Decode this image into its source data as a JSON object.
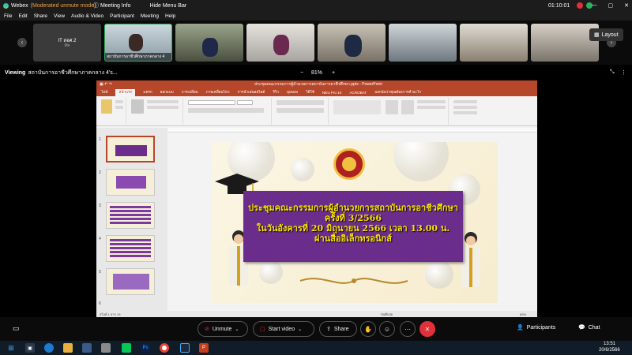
{
  "titlebar": {
    "app_name": "Webex",
    "mode": "(Moderated unmute mode)",
    "meeting_info": "Meeting Info",
    "hide_menu_bar": "Hide Menu Bar",
    "timer": "01:10:01"
  },
  "menu": {
    "file": "File",
    "edit": "Edit",
    "share": "Share",
    "view": "View",
    "audio_video": "Audio & Video",
    "participant": "Participant",
    "meeting": "Meeting",
    "help": "Help"
  },
  "strip": {
    "self_name": "IT สอศ.2",
    "self_sub": "Me",
    "active_label": "สถาบันการอาชีวศึกษาภาคกลาง 4",
    "layout_label": "Layout"
  },
  "viewbar": {
    "viewing": "Viewing",
    "screen_of": "สถาบันการอาชีวศึกษาภาคกลาง 4's...",
    "zoom": "81%"
  },
  "ppt": {
    "filename": "ประชุมคณะกรรมการผู้อำนวยการสถาบันการอาชีวศึกษา.pptx - PowerPoint",
    "tabs": [
      "ไฟล์",
      "หน้าแรก",
      "แทรก",
      "ออกแบบ",
      "การเปลี่ยน",
      "ภาพเคลื่อนไหว",
      "การนำเสนอสไลด์",
      "รีวิว",
      "มุมมอง",
      "วิธีใช้",
      "Nitro Pro 10",
      "ACROBAT"
    ],
    "tell_me": "บอกฉันว่าคุณต้องการทำอะไร",
    "slide_numbers": [
      "1",
      "2",
      "3",
      "4",
      "5",
      "6"
    ],
    "status_left": "สไลด์ 1 จาก 19",
    "status_notes": "บันทึกย่อ",
    "status_zoom": "69%"
  },
  "slide": {
    "line1": "ประชุมคณะกรรมการผู้อำนวยการสถาบันการอาชีวศึกษา",
    "line2": "ครั้งที่ 3/2566",
    "line3": "ในวันอังคารที่ 20 มิถุนายน 2566 เวลา 13.00 น.",
    "line4": "ผ่านสื่ออิเล็กทรอนิกส์"
  },
  "toolbar": {
    "unmute": "Unmute",
    "start_video": "Start video",
    "share": "Share",
    "participants": "Participants",
    "chat": "Chat"
  },
  "taskbar": {
    "time": "13:51",
    "date": "20/6/2566"
  },
  "colors": {
    "ppt_accent": "#b7472a",
    "banner": "#6b2d8c",
    "banner_text": "#f6e200",
    "leave_red": "#e0303a"
  }
}
